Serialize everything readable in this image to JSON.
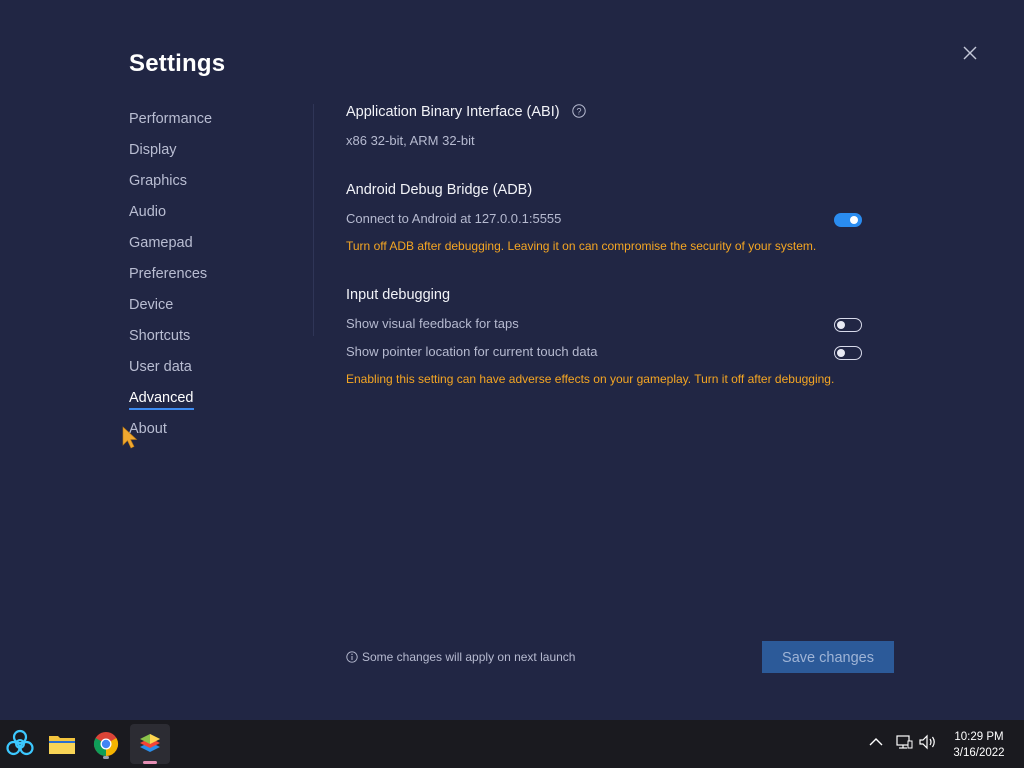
{
  "window": {
    "title": "Settings"
  },
  "sidebar": {
    "items": [
      {
        "label": "Performance"
      },
      {
        "label": "Display"
      },
      {
        "label": "Graphics"
      },
      {
        "label": "Audio"
      },
      {
        "label": "Gamepad"
      },
      {
        "label": "Preferences"
      },
      {
        "label": "Device"
      },
      {
        "label": "Shortcuts"
      },
      {
        "label": "User data"
      },
      {
        "label": "Advanced",
        "active": true
      },
      {
        "label": "About"
      }
    ]
  },
  "abi": {
    "title": "Application Binary Interface (ABI)",
    "value": "x86 32-bit, ARM 32-bit"
  },
  "adb": {
    "title": "Android Debug Bridge (ADB)",
    "connect_label": "Connect to Android at 127.0.0.1:5555",
    "connect_enabled": true,
    "warning": "Turn off ADB after debugging. Leaving it on can compromise the security of your system."
  },
  "input_debugging": {
    "title": "Input debugging",
    "options": [
      {
        "label": "Show visual feedback for taps",
        "enabled": false
      },
      {
        "label": "Show pointer location for current touch data",
        "enabled": false
      }
    ],
    "warning": "Enabling this setting can have adverse effects on your gameplay. Turn it off after debugging."
  },
  "footer": {
    "note": "Some changes will apply on next launch",
    "save_label": "Save changes"
  },
  "taskbar": {
    "apps": [
      "biohazard-app-icon",
      "file-explorer-icon",
      "chrome-icon",
      "bluestacks-icon"
    ],
    "time": "10:29 PM",
    "date": "3/16/2022"
  },
  "colors": {
    "background": "#212644",
    "accent": "#2a8cf0",
    "warning": "#f5a623",
    "button": "#2c5a99"
  }
}
